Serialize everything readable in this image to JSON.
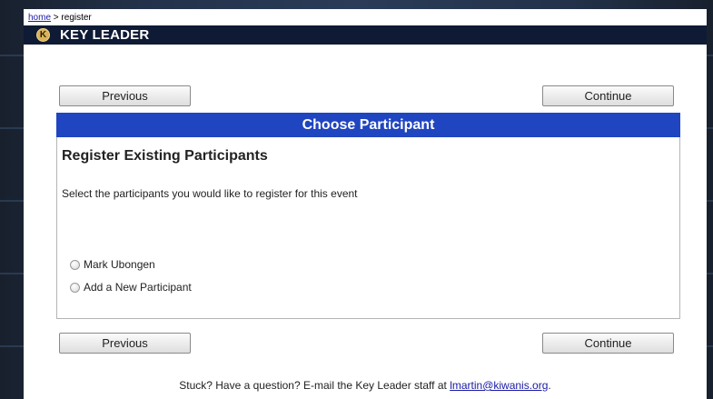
{
  "breadcrumb": {
    "home_label": "home",
    "separator": " > ",
    "current": "register"
  },
  "brand": {
    "logo_glyph": "K",
    "title": "KEY LEADER"
  },
  "nav": {
    "previous_label": "Previous",
    "continue_label": "Continue"
  },
  "section": {
    "header": "Choose Participant",
    "heading": "Register Existing Participants",
    "description": "Select the participants you would like to register for this event"
  },
  "participants": [
    {
      "label": "Mark Ubongen",
      "selected": false
    },
    {
      "label": "Add a New Participant",
      "selected": false
    }
  ],
  "footer": {
    "prompt": "Stuck? Have a question? E-mail the Key Leader staff at ",
    "email": "lmartin@kiwanis.org",
    "suffix": "."
  },
  "colors": {
    "header_blue": "#1f45c0",
    "brand_bar": "#0f1a35",
    "link": "#1a1aa6"
  }
}
